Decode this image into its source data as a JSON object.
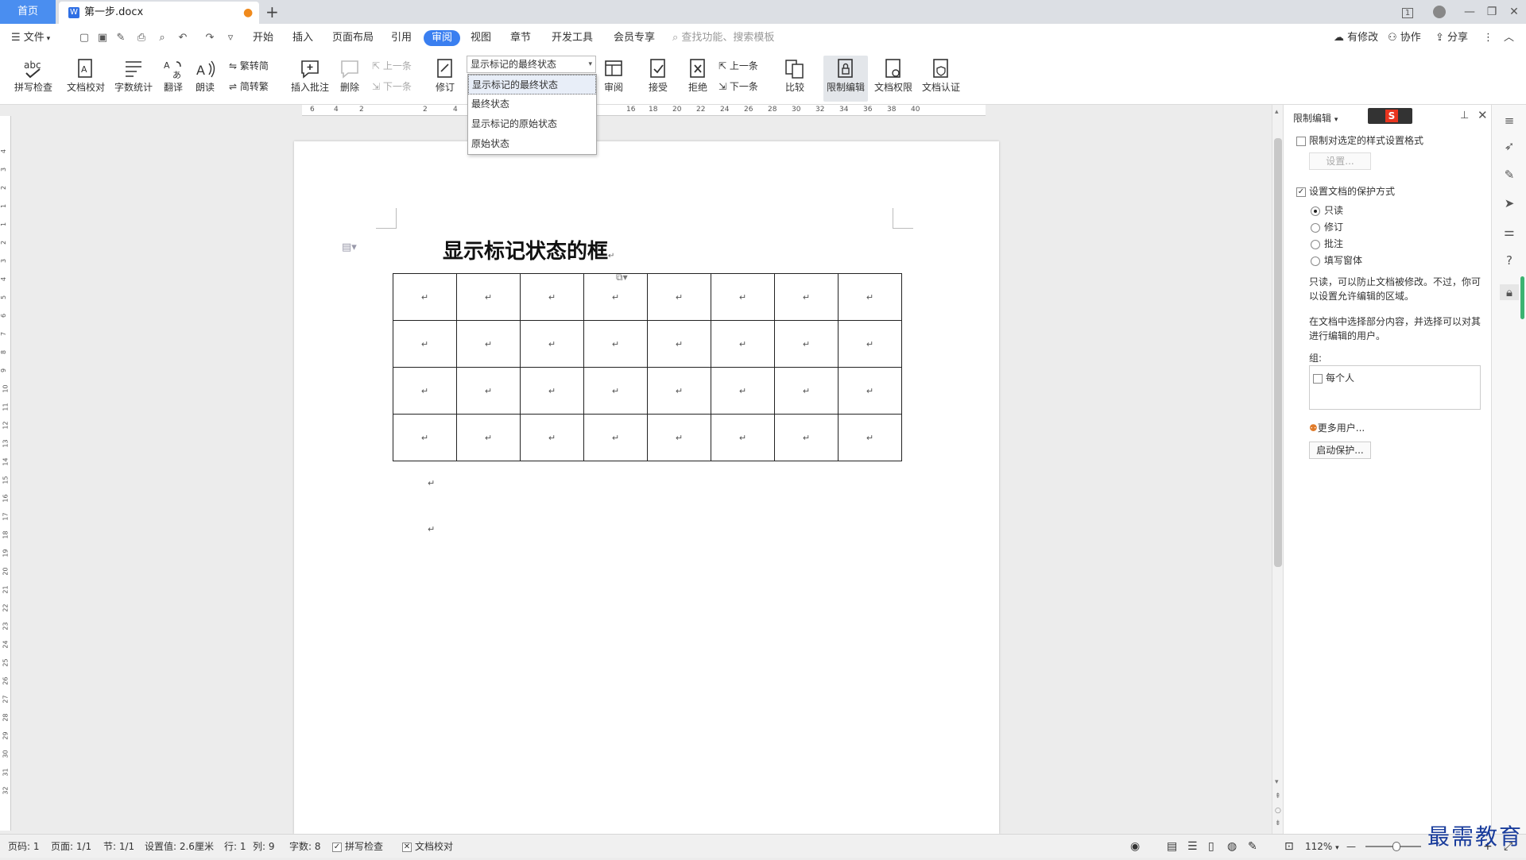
{
  "titlebar": {
    "home_tab": "首页",
    "doc_tab": "第一步.docx",
    "doc_icon": "W",
    "unsaved_dot": "●",
    "new_tab": "+",
    "win_icons": [
      "1",
      "—",
      "❐",
      "✕"
    ]
  },
  "menubar": {
    "file_label": "文件",
    "items": [
      "开始",
      "插入",
      "页面布局",
      "引用",
      "审阅",
      "视图",
      "章节",
      "开发工具",
      "会员专享"
    ],
    "search_placeholder": "查找功能、搜索模板",
    "right_items": [
      "有修改",
      "协作",
      "分享"
    ]
  },
  "ribbon": {
    "spell_check": "拼写检查",
    "doc_check": "文档校对",
    "word_count": "字数统计",
    "translate": "翻译",
    "read_aloud": "朗读",
    "trad_to_simp": "繁转简",
    "simp_to_trad": "简转繁",
    "insert_comment": "插入批注",
    "delete": "删除",
    "prev_comment": "上一条",
    "next_comment": "下一条",
    "track_changes": "修订",
    "review": "审阅",
    "accept": "接受",
    "reject": "拒绝",
    "prev_change": "上一条",
    "next_change": "下一条",
    "compare": "比较",
    "restrict_edit": "限制编辑",
    "doc_permission": "文档权限",
    "doc_certify": "文档认证"
  },
  "status_select": {
    "value": "显示标记的最终状态",
    "options": [
      "显示标记的最终状态",
      "最终状态",
      "显示标记的原始状态",
      "原始状态"
    ]
  },
  "ruler": {
    "h_ticks": [
      "6",
      "4",
      "2",
      "2",
      "4",
      "16",
      "18",
      "20",
      "22",
      "24",
      "26",
      "28",
      "30",
      "32",
      "34",
      "36",
      "38",
      "40"
    ],
    "v_ticks": [
      "4",
      "3",
      "2",
      "1",
      "1",
      "2",
      "3",
      "4",
      "5",
      "6",
      "7",
      "8",
      "9",
      "10",
      "11",
      "12",
      "13",
      "14",
      "15",
      "16",
      "17",
      "18",
      "19",
      "20",
      "21",
      "22",
      "23",
      "24",
      "25",
      "26",
      "27",
      "28",
      "29",
      "30",
      "31",
      "32"
    ]
  },
  "document": {
    "title": "显示标记状态的框",
    "para_mark": "↵",
    "table": {
      "rows": [
        [
          "↵",
          "↵",
          "↵",
          "↵",
          "↵",
          "↵",
          "↵",
          "↵"
        ],
        [
          "↵",
          "↵",
          "↵",
          "↵",
          "↵",
          "↵",
          "↵",
          "↵"
        ],
        [
          "↵",
          "↵",
          "↵",
          "↵",
          "↵",
          "↵",
          "↵",
          "↵"
        ],
        [
          "↵",
          "↵",
          "↵",
          "↵",
          "↵",
          "↵",
          "↵",
          "↵"
        ]
      ]
    }
  },
  "panel": {
    "title": "限制编辑",
    "limit_format_label": "限制对选定的样式设置格式",
    "limit_format_checked": false,
    "settings_button": "设置...",
    "protect_label": "设置文档的保护方式",
    "protect_checked": true,
    "options": [
      "只读",
      "修订",
      "批注",
      "填写窗体"
    ],
    "selected_option": "只读",
    "desc1": "只读，可以防止文档被修改。不过，你可以设置允许编辑的区域。",
    "desc2": "在文档中选择部分内容，并选择可以对其进行编辑的用户。",
    "group_label": "组:",
    "everyone_label": "每个人",
    "more_users": "更多用户...",
    "start_protect": "启动保护..."
  },
  "statusbar": {
    "page_num": "页码: 1",
    "pages": "页面: 1/1",
    "section": "节: 1/1",
    "setting": "设置值: 2.6厘米",
    "row": "行: 1",
    "col": "列: 9",
    "word_count": "字数: 8",
    "spell_check": "拼写检查",
    "doc_check": "文档校对",
    "zoom": "112%",
    "zoom_minus": "—",
    "zoom_plus": "+",
    "zoom_level": 0.55
  },
  "watermark": "最需教育",
  "colors": {
    "accent": "#3a7ff0",
    "home_tab": "#4a8ef0",
    "watermark": "#1a3d9c"
  }
}
